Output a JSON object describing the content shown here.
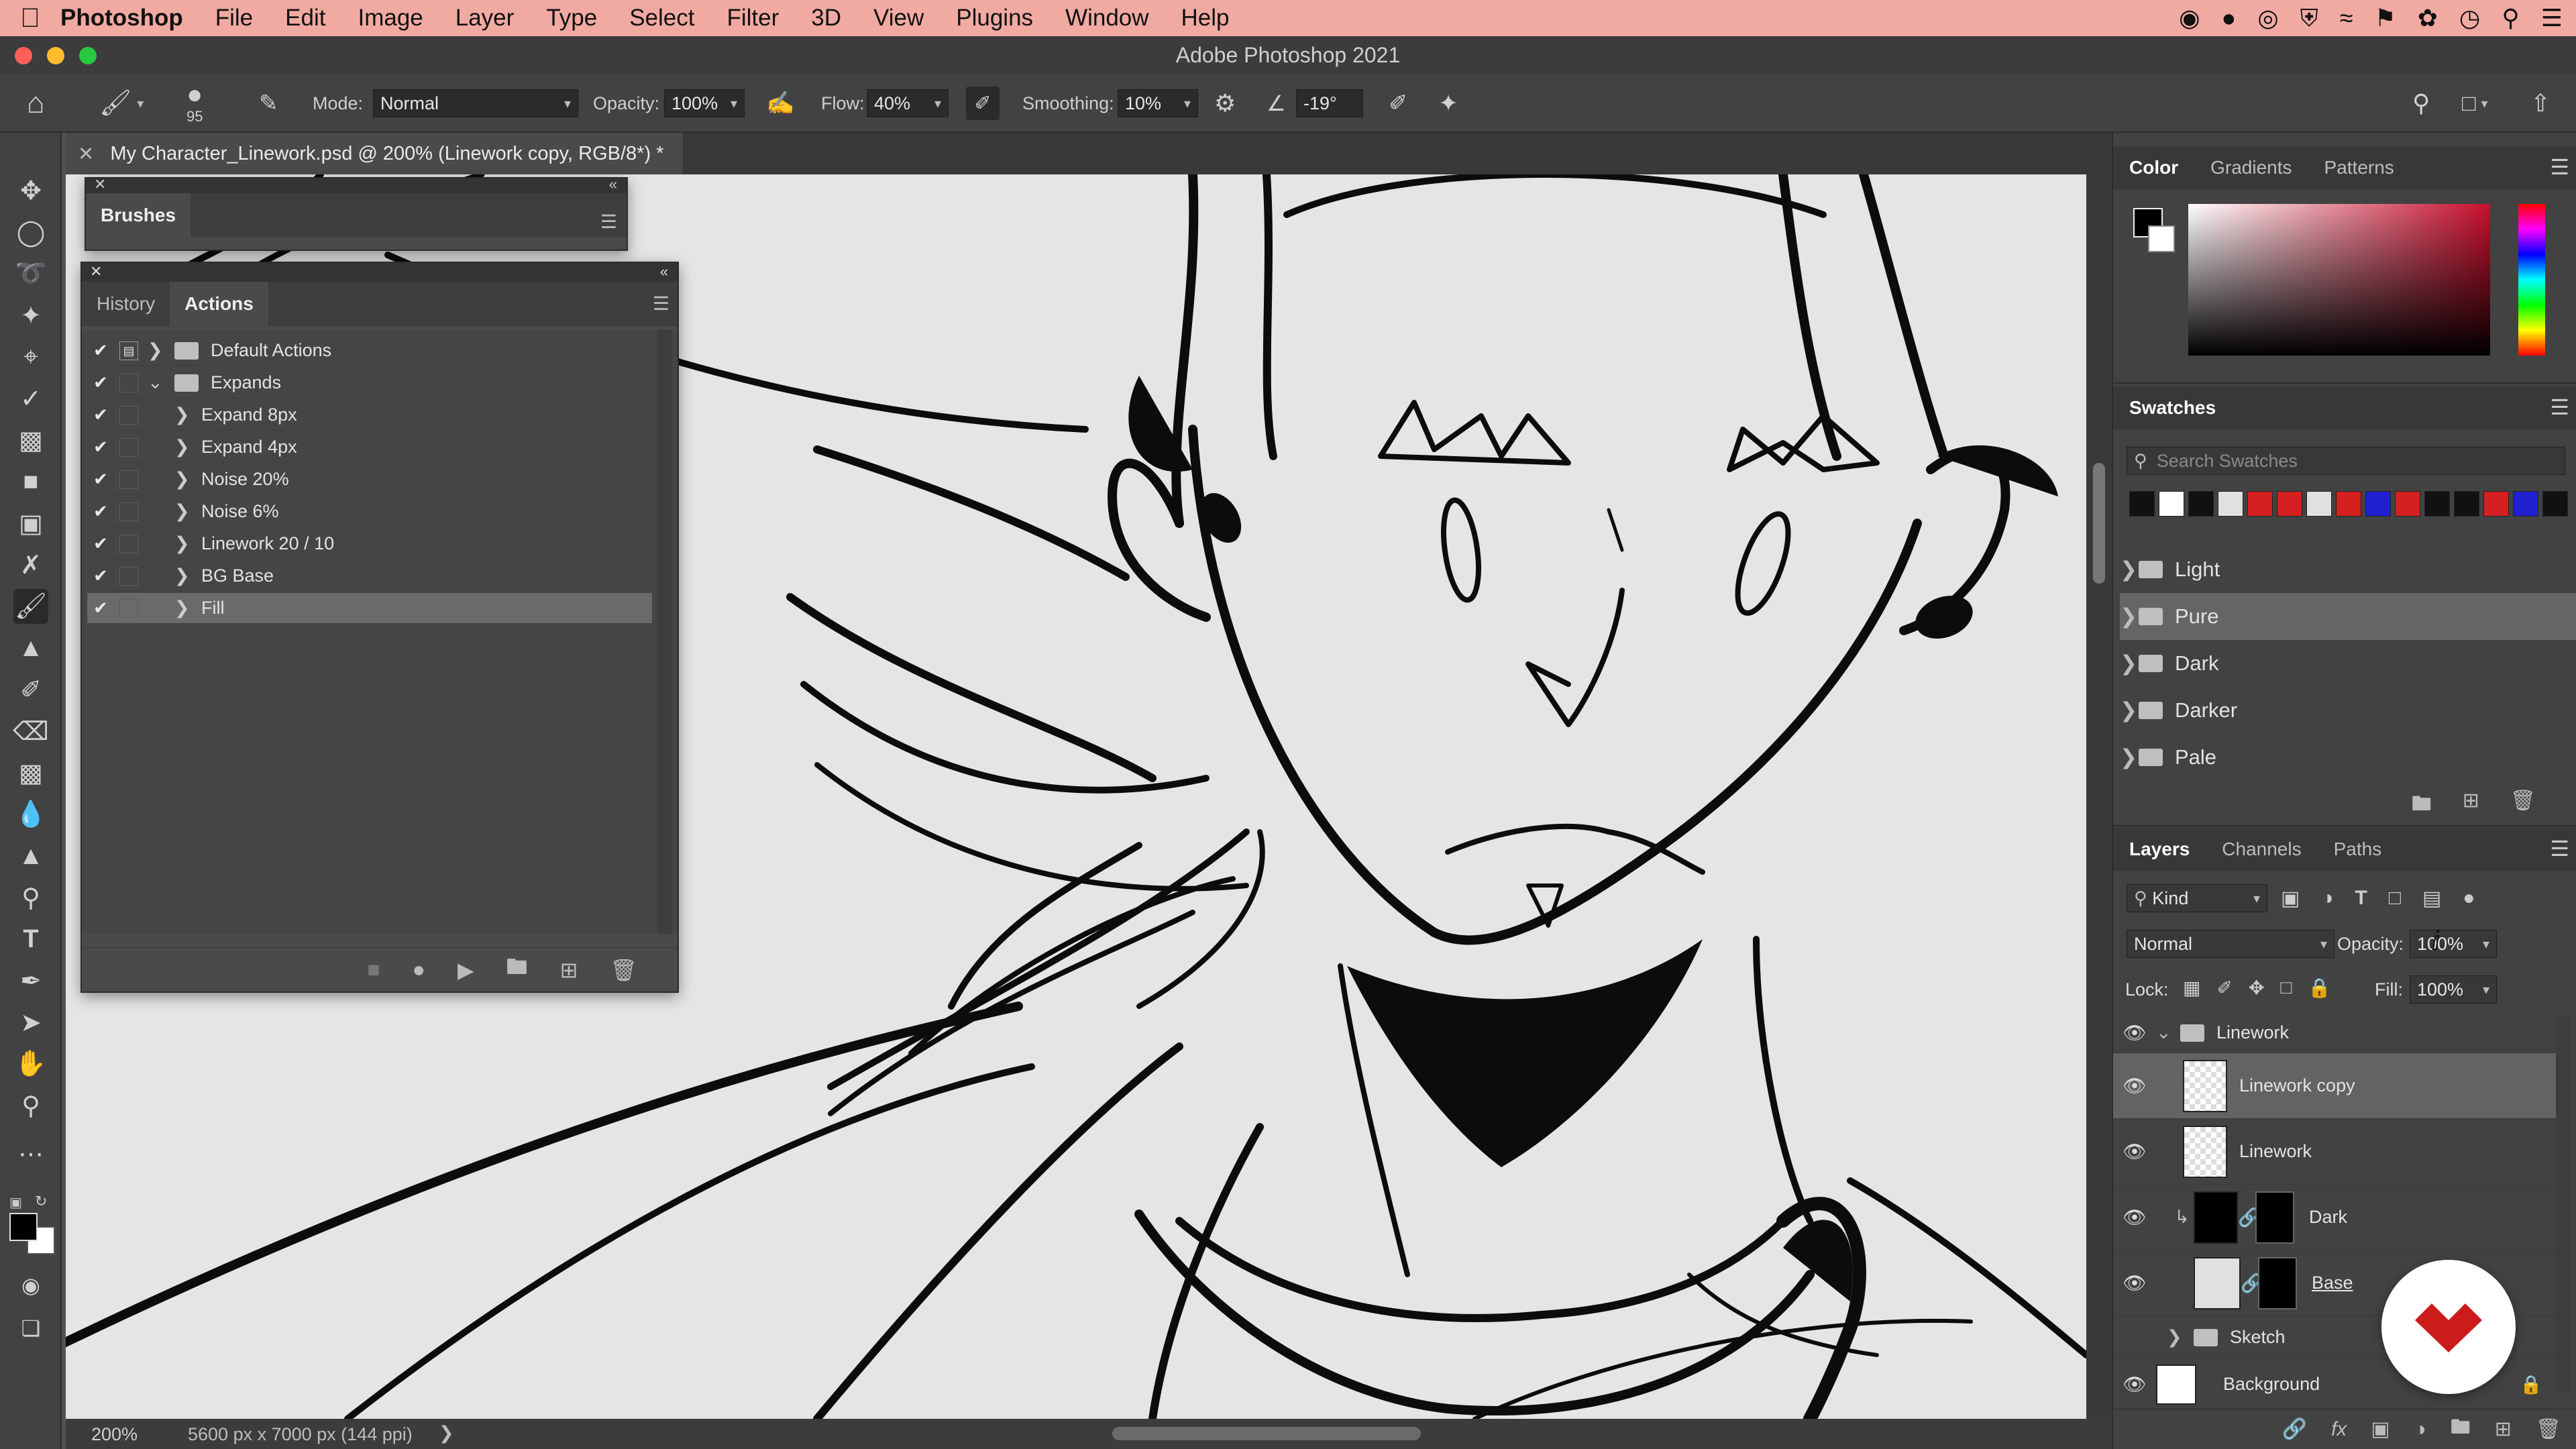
{
  "menubar": {
    "app_name": "Photoshop",
    "items": [
      "File",
      "Edit",
      "Image",
      "Layer",
      "Type",
      "Select",
      "Filter",
      "3D",
      "View",
      "Plugins",
      "Window",
      "Help"
    ]
  },
  "window": {
    "title": "Adobe Photoshop 2021"
  },
  "options": {
    "brush_size": "95",
    "mode_label": "Mode:",
    "mode_value": "Normal",
    "opacity_label": "Opacity:",
    "opacity_value": "100%",
    "flow_label": "Flow:",
    "flow_value": "40%",
    "smoothing_label": "Smoothing:",
    "smoothing_value": "10%",
    "angle_value": "-19°"
  },
  "document": {
    "tab_title": "My Character_Linework.psd @ 200% (Linework copy, RGB/8*) *",
    "zoom": "200%",
    "dimensions": "5600 px x 7000 px (144 ppi)"
  },
  "brushes_panel": {
    "title": "Brushes"
  },
  "actions_panel": {
    "tabs": [
      "History",
      "Actions"
    ],
    "rows": [
      {
        "label": "Default Actions"
      },
      {
        "label": "Expands"
      },
      {
        "label": "Expand 8px"
      },
      {
        "label": "Expand 4px"
      },
      {
        "label": "Noise 20%"
      },
      {
        "label": "Noise 6%"
      },
      {
        "label": "Linework 20 / 10"
      },
      {
        "label": "BG Base"
      },
      {
        "label": "Fill"
      }
    ]
  },
  "color_panel": {
    "tabs": [
      "Color",
      "Gradients",
      "Patterns"
    ]
  },
  "swatches_panel": {
    "title": "Swatches",
    "search_placeholder": "Search Swatches",
    "swatch_colors": [
      "#111111",
      "#ffffff",
      "#111111",
      "#e0e0e0",
      "#d42020",
      "#d42020",
      "#e0e0e0",
      "#d42020",
      "#2020d0",
      "#d42020",
      "#111111",
      "#111111",
      "#d42020",
      "#2020d0",
      "#111111"
    ],
    "groups": [
      "Light",
      "Pure",
      "Dark",
      "Darker",
      "Pale"
    ]
  },
  "layers_panel": {
    "tabs": [
      "Layers",
      "Channels",
      "Paths"
    ],
    "kind_label": "Kind",
    "blend_mode": "Normal",
    "opacity_label": "Opacity:",
    "opacity_value": "100%",
    "lock_label": "Lock:",
    "fill_label": "Fill:",
    "fill_value": "100%",
    "layers": [
      {
        "name": "Linework"
      },
      {
        "name": "Linework copy"
      },
      {
        "name": "Linework"
      },
      {
        "name": "Dark"
      },
      {
        "name": "Base"
      },
      {
        "name": "Sketch"
      },
      {
        "name": "Background"
      }
    ]
  }
}
